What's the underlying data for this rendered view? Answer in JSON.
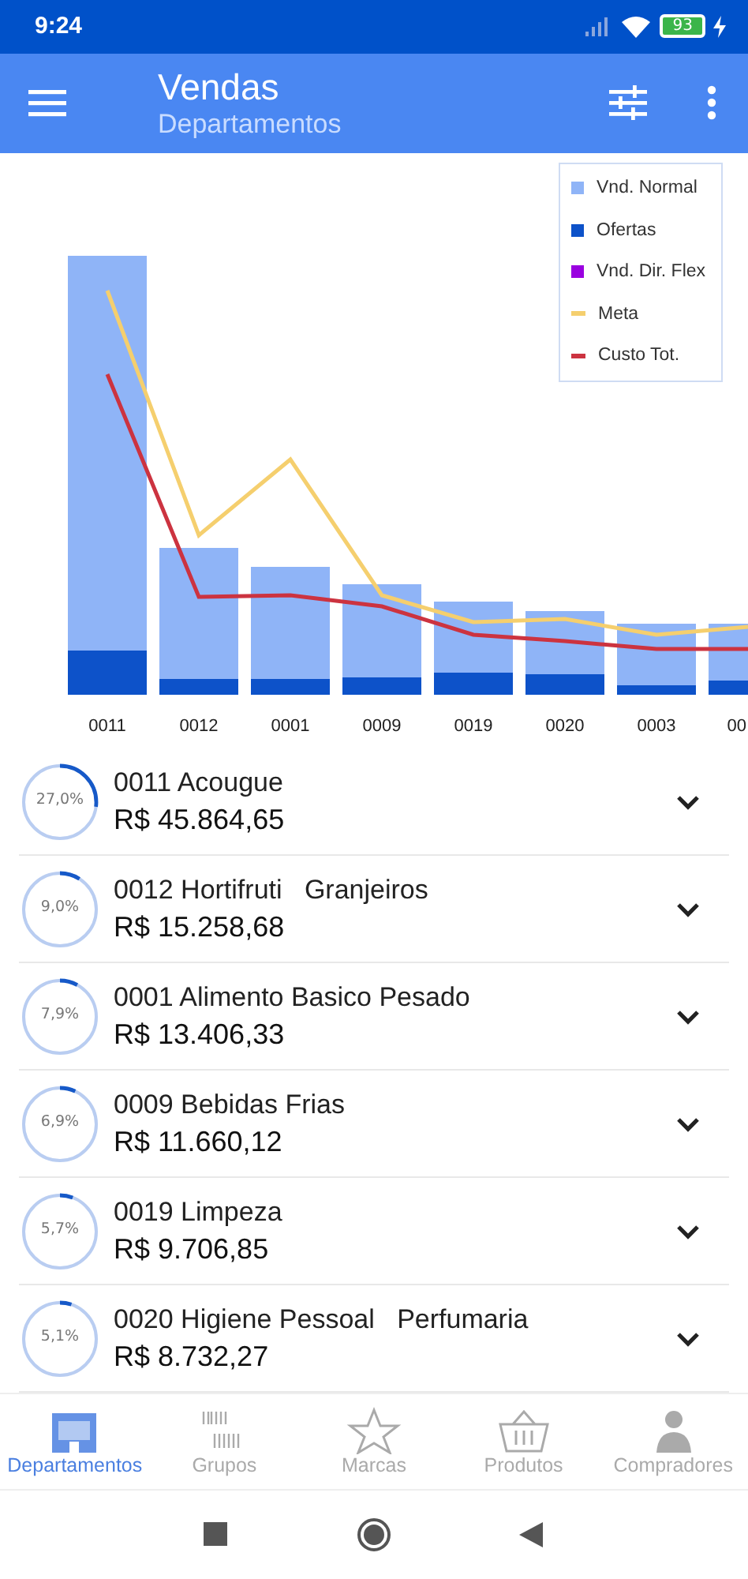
{
  "status_bar": {
    "time": "9:24",
    "battery": "93"
  },
  "app_bar": {
    "title": "Vendas",
    "subtitle": "Departamentos"
  },
  "chart": {
    "legend": [
      {
        "label": "Vnd. Normal",
        "kind": "square",
        "color": "#8fb4f7"
      },
      {
        "label": "Ofertas",
        "kind": "square",
        "color": "#0d52c9"
      },
      {
        "label": "Vnd. Dir. Flex",
        "kind": "square",
        "color": "#9a00e0"
      },
      {
        "label": "Meta",
        "kind": "line",
        "color": "#f5cf6e"
      },
      {
        "label": "Custo Tot.",
        "kind": "line",
        "color": "#cc3340"
      }
    ],
    "categories": [
      "0011",
      "0012",
      "0001",
      "0009",
      "0019",
      "0020",
      "0003",
      "00"
    ]
  },
  "departments": [
    {
      "name": "0011 Acougue",
      "amount": "R$ 45.864,65",
      "share": "27,0%",
      "level": 0.27
    },
    {
      "name": "0012 Hortifruti   Granjeiros",
      "amount": "R$ 15.258,68",
      "share": "9,0%",
      "level": 0.09
    },
    {
      "name": "0001 Alimento Basico Pesado",
      "amount": "R$ 13.406,33",
      "share": "7,9%",
      "level": 0.079
    },
    {
      "name": "0009 Bebidas Frias",
      "amount": "R$ 11.660,12",
      "share": "6,9%",
      "level": 0.069
    },
    {
      "name": "0019 Limpeza",
      "amount": "R$ 9.706,85",
      "share": "5,7%",
      "level": 0.057
    },
    {
      "name": "0020 Higiene Pessoal   Perfumaria",
      "amount": "R$ 8.732,27",
      "share": "5,1%",
      "level": 0.051
    }
  ],
  "bottom_nav": [
    {
      "label": "Departamentos",
      "selected": true
    },
    {
      "label": "Grupos",
      "selected": false
    },
    {
      "label": "Marcas",
      "selected": false
    },
    {
      "label": "Produtos",
      "selected": false
    },
    {
      "label": "Compradores",
      "selected": false
    }
  ]
}
